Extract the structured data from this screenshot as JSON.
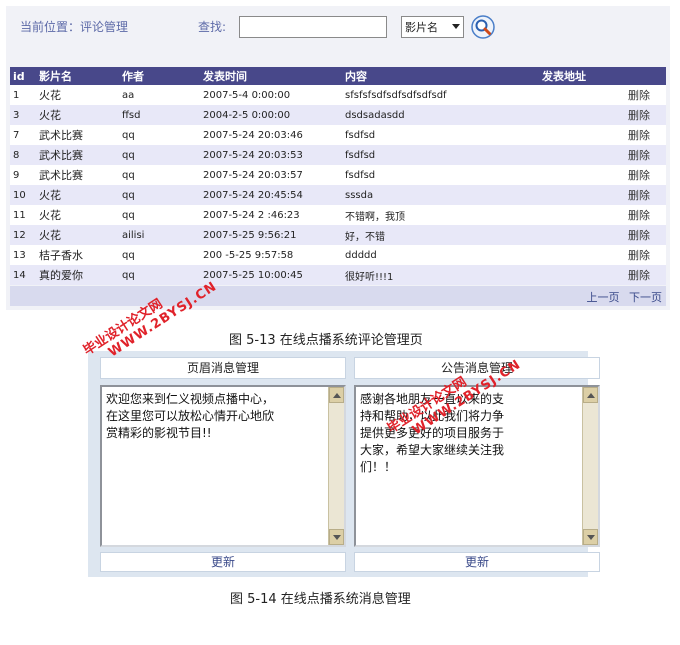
{
  "fig13": {
    "location": "当前位置：评论管理",
    "find_label": "查找:",
    "search_value": "",
    "select_value": "影片名",
    "search_icon": "magnifier-icon",
    "columns": [
      "id",
      "影片名",
      "作者",
      "发表时间",
      "内容",
      "发表地址",
      ""
    ],
    "rows": [
      {
        "id": "1",
        "title": "火花",
        "author": "aa",
        "time": "2007-5-4 0:00:00",
        "content": "sfsfsfsdfsdfsdfsdfsdf",
        "address": "",
        "action": "删除"
      },
      {
        "id": "3",
        "title": "火花",
        "author": "ffsd",
        "time": "2004-2-5 0:00:00",
        "content": "dsdsadasdd",
        "address": "",
        "action": "删除"
      },
      {
        "id": "7",
        "title": "武术比赛",
        "author": "qq",
        "time": "2007-5-24 20:03:46",
        "content": "fsdfsd",
        "address": "",
        "action": "删除"
      },
      {
        "id": "8",
        "title": "武术比赛",
        "author": "qq",
        "time": "2007-5-24 20:03:53",
        "content": "fsdfsd",
        "address": "",
        "action": "删除"
      },
      {
        "id": "9",
        "title": "武术比赛",
        "author": "qq",
        "time": "2007-5-24 20:03:57",
        "content": "fsdfsd",
        "address": "",
        "action": "删除"
      },
      {
        "id": "10",
        "title": "火花",
        "author": "qq",
        "time": "2007-5-24 20:45:54",
        "content": "sssda",
        "address": "",
        "action": "删除"
      },
      {
        "id": "11",
        "title": "火花",
        "author": "qq",
        "time": "2007-5-24 2 :46:23",
        "content": "不错啊，我顶",
        "address": "",
        "action": "删除"
      },
      {
        "id": "12",
        "title": "火花",
        "author": "ailisi",
        "time": "2007-5-25 9:56:21",
        "content": "好，不错",
        "address": "",
        "action": "删除"
      },
      {
        "id": "13",
        "title": "桔子香水",
        "author": "qq",
        "time": "200 -5-25 9:57:58",
        "content": "ddddd",
        "address": "",
        "action": "删除"
      },
      {
        "id": "14",
        "title": "真的爱你",
        "author": "qq",
        "time": "2007-5-25 10:00:45",
        "content": "很好听!!!1",
        "address": "",
        "action": "删除"
      }
    ],
    "pager": {
      "prev": "上一页",
      "next": "下一页"
    },
    "caption": "图 5-13 在线点播系统评论管理页"
  },
  "fig14": {
    "left": {
      "header": "页眉消息管理",
      "text": "欢迎您来到仁义视频点播中心，\n在这里您可以放松心情开心地欣\n赏精彩的影视节目!!",
      "update": "更新"
    },
    "right": {
      "header": "公告消息管理",
      "text": "感谢各地朋友一直以来的支\n持和帮助，以此我们将力争\n提供更多更好的项目服务于\n大家，希望大家继续关注我\n们！！",
      "update": "更新"
    },
    "caption": "图 5-14 在线点播系统消息管理"
  },
  "watermark": {
    "line1": "毕业设计论文网",
    "line2": "WWW.2BYSJ.CN"
  },
  "colors": {
    "table_header": "#48488a",
    "row_alt": "#e8e8f8",
    "watermark": "#e0222a",
    "panel_bg": "#f1f2f7"
  }
}
